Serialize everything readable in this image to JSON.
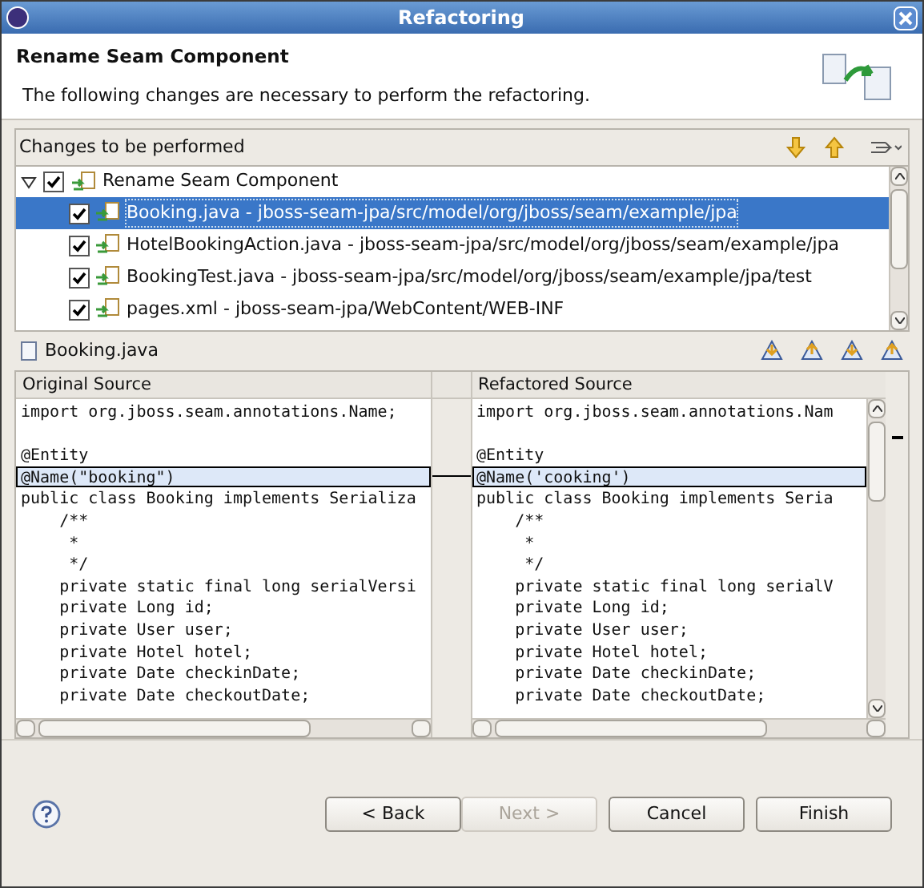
{
  "window": {
    "title": "Refactoring"
  },
  "header": {
    "title": "Rename Seam Component",
    "description": "The following changes are necessary to perform the refactoring."
  },
  "changes": {
    "title": "Changes to be performed",
    "tree": [
      {
        "label": "Rename Seam Component",
        "checked": true,
        "expanded": true,
        "selected": false,
        "children": [
          {
            "label": "Booking.java - jboss-seam-jpa/src/model/org/jboss/seam/example/jpa",
            "checked": true,
            "selected": true
          },
          {
            "label": "HotelBookingAction.java - jboss-seam-jpa/src/model/org/jboss/seam/example/jpa",
            "checked": true,
            "selected": false
          },
          {
            "label": "BookingTest.java - jboss-seam-jpa/src/model/org/jboss/seam/example/jpa/test",
            "checked": true,
            "selected": false
          },
          {
            "label": "pages.xml - jboss-seam-jpa/WebContent/WEB-INF",
            "checked": true,
            "selected": false
          }
        ]
      }
    ]
  },
  "compare": {
    "file": "Booking.java",
    "panes": [
      {
        "title": "Original Source",
        "lines": [
          {
            "text": "import org.jboss.seam.annotations.Name;",
            "highlighted": false
          },
          {
            "highlighted": false
          },
          {
            "text": "@Entity",
            "highlighted": false
          },
          {
            "text": "@Name(\"booking\")",
            "highlighted": true
          },
          {
            "text": "public class Booking implements Serializa",
            "highlighted": false
          },
          {
            "text": "    /**",
            "highlighted": false
          },
          {
            "text": "     *",
            "highlighted": false
          },
          {
            "text": "     */",
            "highlighted": false
          },
          {
            "text": "    private static final long serialVersi",
            "highlighted": false
          },
          {
            "text": "    private Long id;",
            "highlighted": false
          },
          {
            "text": "    private User user;",
            "highlighted": false
          },
          {
            "text": "    private Hotel hotel;",
            "highlighted": false
          },
          {
            "text": "    private Date checkinDate;",
            "highlighted": false
          },
          {
            "text": "    private Date checkoutDate;",
            "highlighted": false
          }
        ]
      },
      {
        "title": "Refactored Source",
        "lines": [
          {
            "text": "import org.jboss.seam.annotations.Nam",
            "highlighted": false
          },
          {
            "highlighted": false
          },
          {
            "text": "@Entity",
            "highlighted": false
          },
          {
            "text": "@Name('cooking')",
            "highlighted": true
          },
          {
            "text": "public class Booking implements Seria",
            "highlighted": false
          },
          {
            "text": "    /**",
            "highlighted": false
          },
          {
            "text": "     *",
            "highlighted": false
          },
          {
            "text": "     */",
            "highlighted": false
          },
          {
            "text": "    private static final long serialV",
            "highlighted": false
          },
          {
            "text": "    private Long id;",
            "highlighted": false
          },
          {
            "text": "    private User user;",
            "highlighted": false
          },
          {
            "text": "    private Hotel hotel;",
            "highlighted": false
          },
          {
            "text": "    private Date checkinDate;",
            "highlighted": false
          },
          {
            "text": "    private Date checkoutDate;",
            "highlighted": false
          }
        ]
      }
    ]
  },
  "buttons": [
    {
      "label": "< Back",
      "disabled": false
    },
    {
      "label": "Next >",
      "disabled": true
    },
    {
      "label": "Cancel",
      "disabled": false
    },
    {
      "label": "Finish",
      "disabled": false
    }
  ]
}
